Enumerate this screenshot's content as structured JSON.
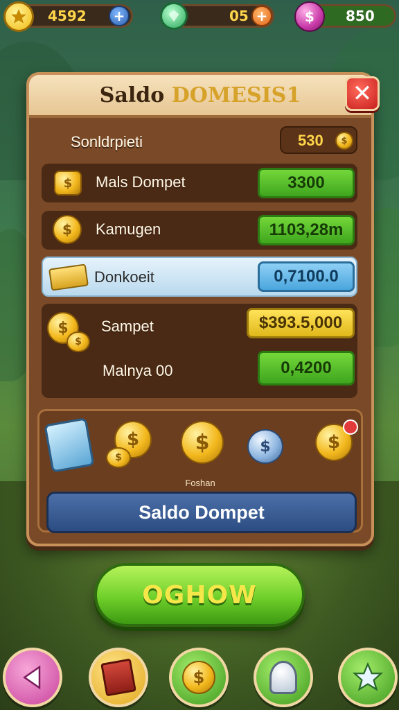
{
  "topbar": {
    "currency_1": "4592",
    "currency_2": "05",
    "currency_3": "850"
  },
  "dialog": {
    "title_part1": "Saldo ",
    "title_part2": "DOMESIS1",
    "balance_label": "Sonldrpieti",
    "balance_value": "530",
    "rows": [
      {
        "label": "Mals Dompet",
        "value": "3300",
        "style": "green"
      },
      {
        "label": "Kamugen",
        "value": "1103,28m",
        "style": "green"
      },
      {
        "label": "Donkoeit",
        "value": "0,7100.0",
        "style": "blue"
      },
      {
        "label": "Sampet",
        "value": "$393.5,000",
        "style": "yellow"
      },
      {
        "label": "Malnya 00",
        "value": "0,4200",
        "style": "green"
      }
    ],
    "tray_caption": "Foshan",
    "primary_button": "Saldo Dompet"
  },
  "go_button": "OGHOW",
  "icons": {
    "star": "star-icon",
    "gem": "gem-icon",
    "coin": "coin-icon",
    "close": "close-icon",
    "back": "back-arrow-icon",
    "book": "book-icon",
    "coins": "coin-stack-icon",
    "trophy": "trophy-icon",
    "favorite": "star-icon"
  },
  "colors": {
    "panel": "#7a4a28",
    "accent_green": "#3ea51e",
    "accent_blue": "#4aa6dd",
    "accent_yellow": "#e0b81a",
    "title_gold": "#d6a22a"
  }
}
